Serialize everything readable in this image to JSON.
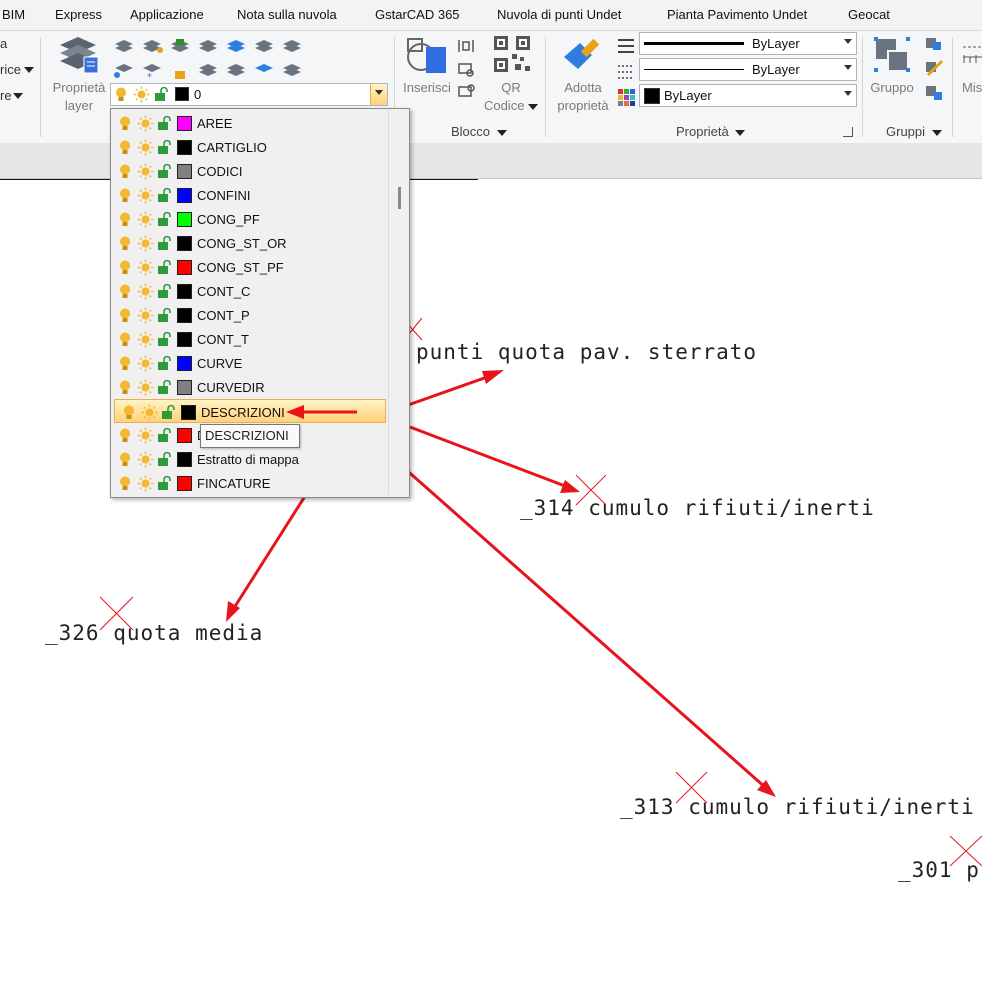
{
  "menubar": {
    "items": [
      "BIM",
      "Express",
      "Applicazione",
      "Nota sulla nuvola",
      "GstarCAD 365",
      "Nuvola di punti Undet",
      "Pianta Pavimento Undet",
      "Geocat"
    ]
  },
  "ribbon": {
    "left_cut": {
      "line1": "a",
      "line2": "rice",
      "line3": "re"
    },
    "layer_properties_label": {
      "line1": "Proprietà",
      "line2": "layer"
    },
    "current_layer_value": "0",
    "insert_label": "Inserisci",
    "qr_label": {
      "line1": "QR",
      "line2": "Codice"
    },
    "block_group_label": "Blocco",
    "adopt_label": {
      "line1": "Adotta",
      "line2": "proprietà"
    },
    "linetype_value": "ByLayer",
    "lineweight_value": "ByLayer",
    "color_value": "ByLayer",
    "properties_group_label": "Proprietà",
    "group_label": "Gruppo",
    "groups_group_label": "Gruppi",
    "measure_cut_label": "Mis"
  },
  "layer_dropdown": {
    "layers": [
      {
        "name": "AREE",
        "color": "#ff00ff"
      },
      {
        "name": "CARTIGLIO",
        "color": "#000000"
      },
      {
        "name": "CODICI",
        "color": "#808080"
      },
      {
        "name": "CONFINI",
        "color": "#0000ff"
      },
      {
        "name": "CONG_PF",
        "color": "#00ff00"
      },
      {
        "name": "CONG_ST_OR",
        "color": "#000000"
      },
      {
        "name": "CONG_ST_PF",
        "color": "#ff0000"
      },
      {
        "name": "CONT_C",
        "color": "#000000"
      },
      {
        "name": "CONT_P",
        "color": "#000000"
      },
      {
        "name": "CONT_T",
        "color": "#000000"
      },
      {
        "name": "CURVE",
        "color": "#0000ff"
      },
      {
        "name": "CURVEDIR",
        "color": "#808080"
      },
      {
        "name": "DESCRIZIONI",
        "color": "#000000",
        "selected": true
      },
      {
        "name": "DESCRIZIONI",
        "color": "#ff0000"
      },
      {
        "name": "Estratto di mappa",
        "color": "#000000"
      },
      {
        "name": "FINCATURE",
        "color": "#ff0000"
      }
    ],
    "tooltip": "DESCRIZIONI"
  },
  "drawing": {
    "labels": [
      {
        "text": "punti quota pav. sterrato"
      },
      {
        "text": "_314 cumulo rifiuti/inerti"
      },
      {
        "text": "_326 quota media"
      },
      {
        "text": "_313 cumulo rifiuti/inerti"
      },
      {
        "text": "_301 p"
      }
    ],
    "arrow_color": "#e8141c",
    "point_marker_color": "#e8141c"
  }
}
